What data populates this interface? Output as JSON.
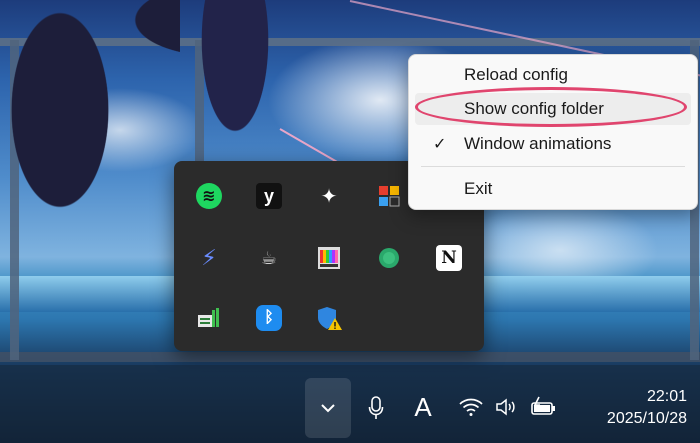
{
  "context_menu": {
    "items": [
      {
        "label": "Reload config",
        "checked": false
      },
      {
        "label": "Show config folder",
        "checked": false,
        "highlighted": true
      },
      {
        "label": "Window animations",
        "checked": true
      },
      {
        "label": "Exit",
        "checked": false
      }
    ],
    "check_glyph": "✓"
  },
  "flyout": {
    "icons": [
      {
        "name": "spotify-icon",
        "glyph": "≋"
      },
      {
        "name": "yandex-icon",
        "glyph": "y"
      },
      {
        "name": "eagle-icon",
        "glyph": "✦"
      },
      {
        "name": "app-grid-icon",
        "glyph": "▦"
      },
      {
        "name": "lightning-icon",
        "glyph": "⚡"
      },
      {
        "name": "cup-icon",
        "glyph": "☕"
      },
      {
        "name": "color-bars-icon",
        "glyph": "▥"
      },
      {
        "name": "green-circle-icon",
        "glyph": "●"
      },
      {
        "name": "notion-icon",
        "glyph": "N"
      },
      {
        "name": "network-map-icon",
        "glyph": "▤"
      },
      {
        "name": "bluetooth-icon",
        "glyph": "ᛒ"
      },
      {
        "name": "defender-warning-icon",
        "glyph": "⚠"
      }
    ]
  },
  "taskbar": {
    "overflow_glyph": "⌄",
    "mic_glyph": "🎤",
    "ime_label": "A",
    "wifi_glyph": "≋",
    "volume_glyph": "🔈",
    "battery_glyph": "▭",
    "time": "22:01",
    "date": "2025/10/28"
  }
}
